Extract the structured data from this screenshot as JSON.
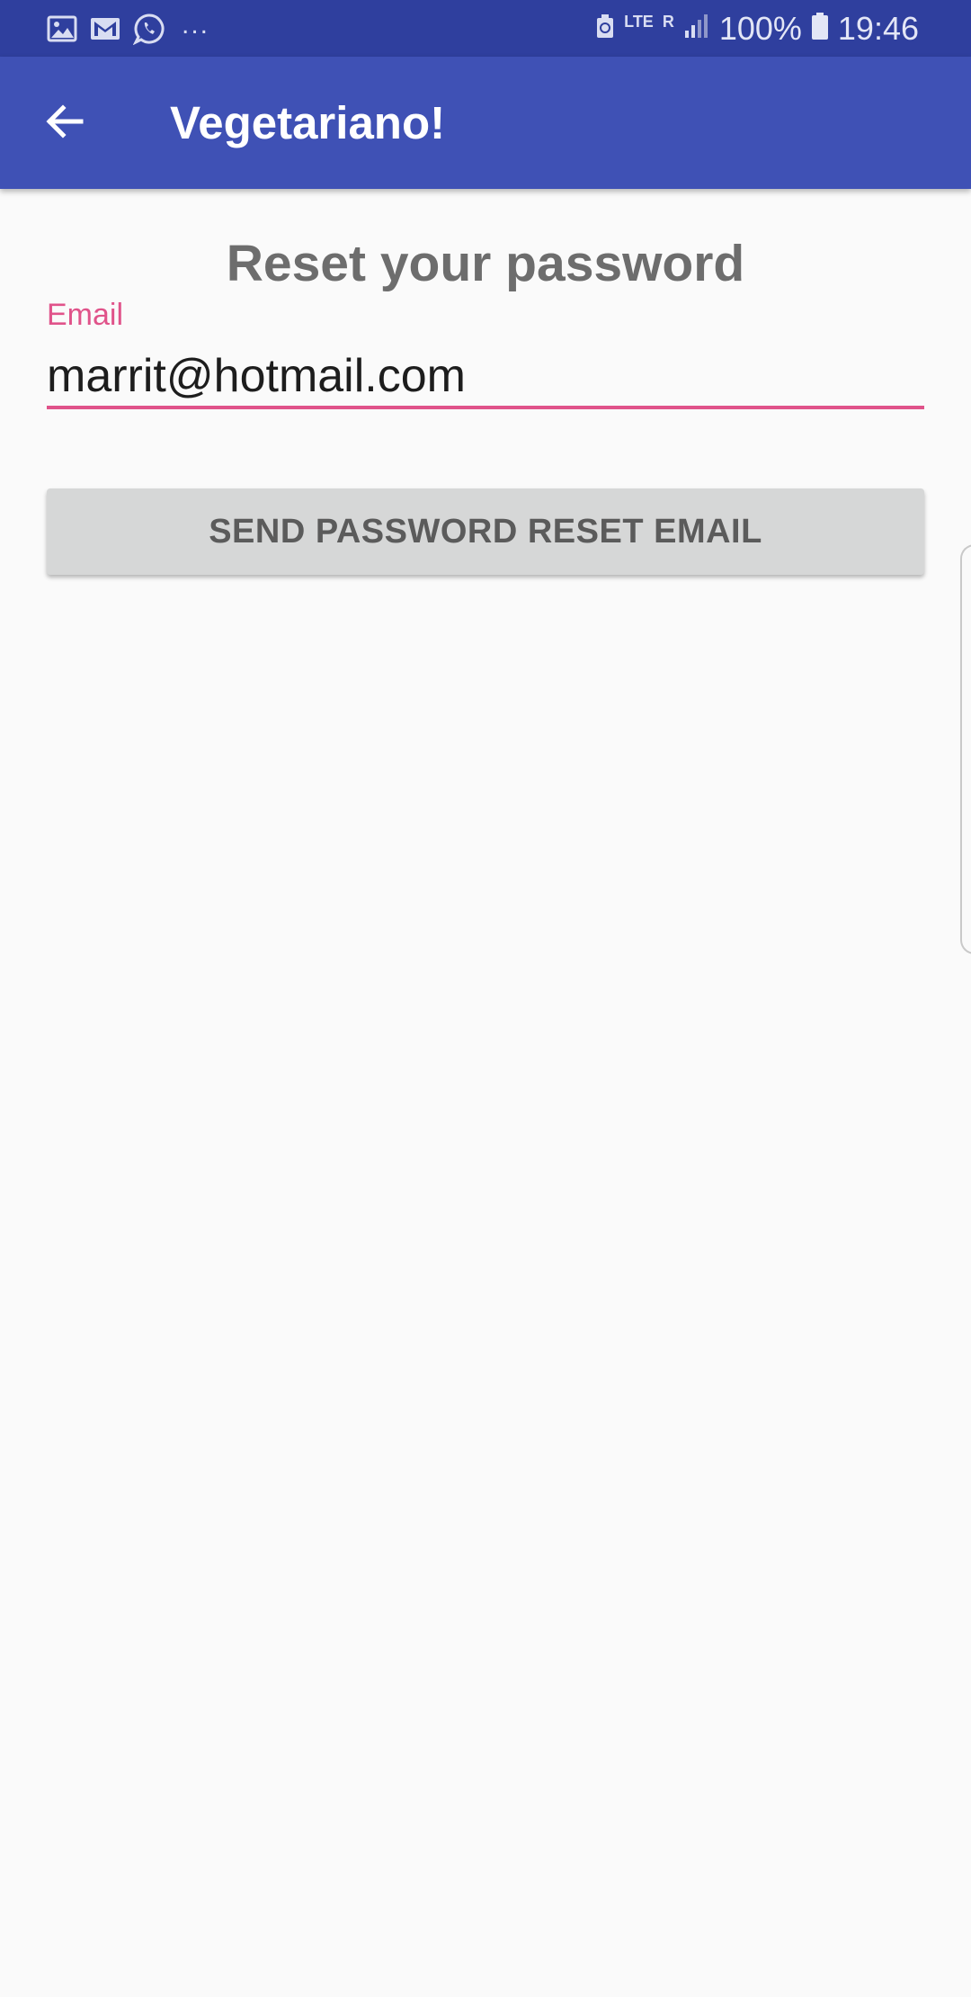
{
  "status_bar": {
    "notification_icons": [
      "gallery-icon",
      "gmail-icon",
      "whatsapp-icon"
    ],
    "more_indicator": "...",
    "network_type": "LTE",
    "roaming_indicator": "R",
    "battery_percent": "100%",
    "time": "19:46"
  },
  "app_bar": {
    "back_icon": "arrow-left-icon",
    "title": "Vegetariano!"
  },
  "main": {
    "heading": "Reset your password",
    "email_label": "Email",
    "email_value": "marrit@hotmail.com",
    "reset_button_label": "SEND PASSWORD RESET EMAIL"
  },
  "colors": {
    "status_bar": "#2f3f9e",
    "app_bar": "#3f51b5",
    "accent": "#e0538a",
    "background": "#fafafa",
    "button": "#d6d7d7"
  }
}
